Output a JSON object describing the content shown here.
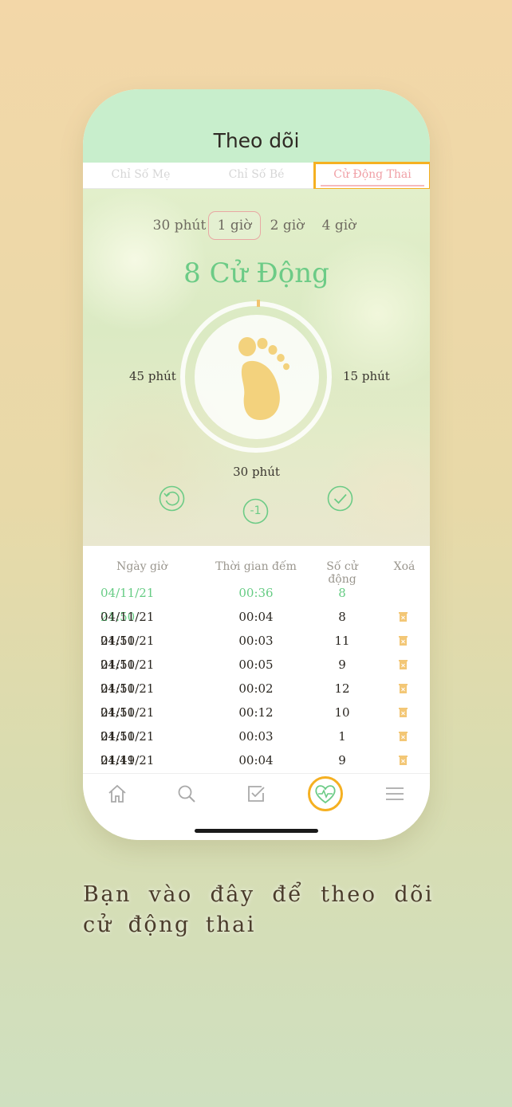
{
  "header": {
    "title": "Theo dõi"
  },
  "tabs": [
    {
      "label": "Chỉ Số Mẹ"
    },
    {
      "label": "Chỉ Số Bé"
    },
    {
      "label": "Cử Động Thai",
      "selected": true
    }
  ],
  "time_options": [
    "30 phút",
    "1 giờ",
    "2 giờ",
    "4 giờ"
  ],
  "selected_time": "1 giờ",
  "counter": {
    "value": "8 Cử Động"
  },
  "dial": {
    "left_label": "45 phút",
    "right_label": "15 phút",
    "bottom_label": "30 phút"
  },
  "controls": {
    "reset_icon": "refresh-icon",
    "minus_label": "-1",
    "confirm_icon": "check-icon"
  },
  "table": {
    "headers": [
      "Ngày giờ",
      "Thời gian đếm",
      "Số cử động",
      "Xoá"
    ],
    "rows": [
      {
        "datetime": "04/11/21 21:50",
        "duration": "00:36",
        "count": "8",
        "current": true
      },
      {
        "datetime": "04/11/21 21:50",
        "duration": "00:04",
        "count": "8"
      },
      {
        "datetime": "04/11/21 21:50",
        "duration": "00:03",
        "count": "11"
      },
      {
        "datetime": "04/11/21 21:50",
        "duration": "00:05",
        "count": "9"
      },
      {
        "datetime": "04/11/21 21:50",
        "duration": "00:02",
        "count": "12"
      },
      {
        "datetime": "04/11/21 21:50",
        "duration": "00:12",
        "count": "10"
      },
      {
        "datetime": "04/11/21 21:49",
        "duration": "00:03",
        "count": "1"
      },
      {
        "datetime": "04/11/21 19:54",
        "duration": "00:04",
        "count": "9"
      }
    ]
  },
  "tabbar": {
    "items": [
      "home-icon",
      "search-icon",
      "checklist-icon",
      "heart-pulse-icon",
      "menu-icon"
    ],
    "active": "heart-pulse-icon"
  },
  "colors": {
    "accent_green": "#6ccb86",
    "highlight_orange": "#f5b021",
    "header_green": "#c8eecc",
    "pink": "#f0a0a6",
    "foot_yellow": "#f3d27d"
  },
  "caption": "Bạn vào đây để theo dõi cử động thai"
}
